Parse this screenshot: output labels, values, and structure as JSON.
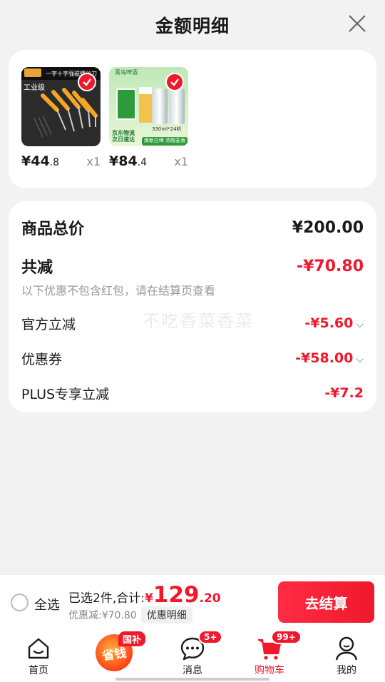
{
  "header": {
    "title": "金额明细"
  },
  "products": [
    {
      "price_int": "¥44",
      "price_dec": ".8",
      "qty": "x1",
      "badge_text": "工业级",
      "banner": "一字十字强磁螺丝刀"
    },
    {
      "price_int": "¥84",
      "price_dec": ".4",
      "qty": "x1",
      "promo_top": "青岛啤酒",
      "promo_bottom": "京东物流 次日速达",
      "slogan": "焕新白啤 浓醇麦香",
      "can_size": "330ml*24听"
    }
  ],
  "summary": {
    "total_label": "商品总价",
    "total_value": "¥200.00",
    "discount_label": "共减",
    "discount_value": "-¥70.80",
    "hint": "以下优惠不包含红包，请在结算页查看",
    "items": [
      {
        "label": "官方立减",
        "value": "-¥5.60"
      },
      {
        "label": "优惠券",
        "value": "-¥58.00"
      },
      {
        "label": "PLUS专享立减",
        "value": "-¥7.2"
      }
    ]
  },
  "watermark": "不吃香菜香菜",
  "checkout": {
    "select_all": "全选",
    "selected_text": "已选2件,合计:",
    "total_cur": "¥",
    "total_int": "129",
    "total_dec": ".20",
    "discount_text": "优惠减:¥70.80",
    "detail_chip": "优惠明细",
    "pay_button": "去结算"
  },
  "tabbar": {
    "tabs": [
      {
        "label": "首页"
      },
      {
        "label": "省钱",
        "badge": "国补"
      },
      {
        "label": "消息",
        "badge": "5+"
      },
      {
        "label": "购物车",
        "badge": "99+"
      },
      {
        "label": "我的"
      }
    ]
  },
  "colors": {
    "accent": "#f0182b",
    "background": "#f2f2f2"
  }
}
